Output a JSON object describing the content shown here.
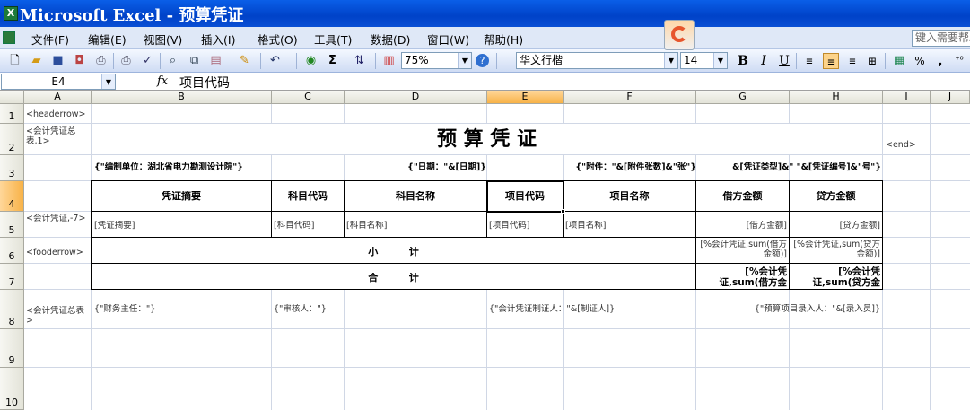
{
  "app": {
    "title": "Microsoft Excel - 预算凭证",
    "icon": "excel-icon"
  },
  "menu": {
    "items": [
      "文件(F)",
      "编辑(E)",
      "视图(V)",
      "插入(I)",
      "格式(O)",
      "工具(T)",
      "数据(D)",
      "窗口(W)",
      "帮助(H)"
    ],
    "help_placeholder": "键入需要帮助"
  },
  "toolbar": {
    "zoom": "75%",
    "font_name": "华文行楷",
    "font_size": "14",
    "bold_label": "B",
    "italic_label": "I",
    "underline_label": "U",
    "percent_label": "%",
    "comma_label": ",",
    "sigma_label": "Σ",
    "icons": [
      "new-icon",
      "open-icon",
      "save-icon",
      "permission-icon",
      "print-icon",
      "print-preview-icon",
      "spelling-icon",
      "research-icon",
      "copy-icon",
      "paste-icon",
      "format-painter-icon",
      "undo-icon",
      "hyperlink-icon",
      "autosum-icon",
      "sort-icon",
      "chart-icon",
      "help-icon",
      "align-left-icon",
      "align-center-icon",
      "align-right-icon",
      "merge-center-icon",
      "currency-icon",
      "increase-decimal-icon"
    ]
  },
  "formula_bar": {
    "name_box": "E4",
    "fx": "fx",
    "value": "项目代码"
  },
  "columns": [
    "A",
    "B",
    "C",
    "D",
    "E",
    "F",
    "G",
    "H",
    "I",
    "J"
  ],
  "active_column": "E",
  "rows": [
    "1",
    "2",
    "3",
    "4",
    "5",
    "6",
    "7",
    "8",
    "9",
    "10"
  ],
  "active_row": "4",
  "sheet": {
    "A1": "<headerrow>",
    "A2": "<会计凭证总表,1>",
    "title": "预 算 凭 证",
    "I2": "<end>",
    "B3": "{\"编制单位：湖北省电力勘测设计院\"}",
    "D3": "{\"日期：\"&[日期]}",
    "E3": "{\"附件：\"&[附件张数]&\"张\"}",
    "H3": "&[凭证类型]&\" \"&[凭证编号]&\"号\"}",
    "header": [
      "凭证摘要",
      "科目代码",
      "科目名称",
      "项目代码",
      "项目名称",
      "借方金额",
      "贷方金额"
    ],
    "A5": "<会计凭证,-7>",
    "row5": [
      "[凭证摘要]",
      "[科目代码]",
      "[科目名称]",
      "[项目代码]",
      "[项目名称]",
      "[借方金额]",
      "[贷方金额]"
    ],
    "A6": "<fooderrow>",
    "subtotal": "小         计",
    "G6": "[%会计凭证,sum(借方金额)]",
    "H6": "[%会计凭证,sum(贷方金额)]",
    "total": "合         计",
    "G7": "[%会计凭证,sum(借方金",
    "H7": "[%会计凭证,sum(贷方金",
    "A8": "<会计凭证总表>",
    "B8": "{\"财务主任：\"}",
    "C8": "{\"审核人：\"}",
    "E8": "{\"会计凭证制证人：\"&[制证人]}",
    "G8": "{\"预算项目录入人：\"&[录入员]}"
  }
}
